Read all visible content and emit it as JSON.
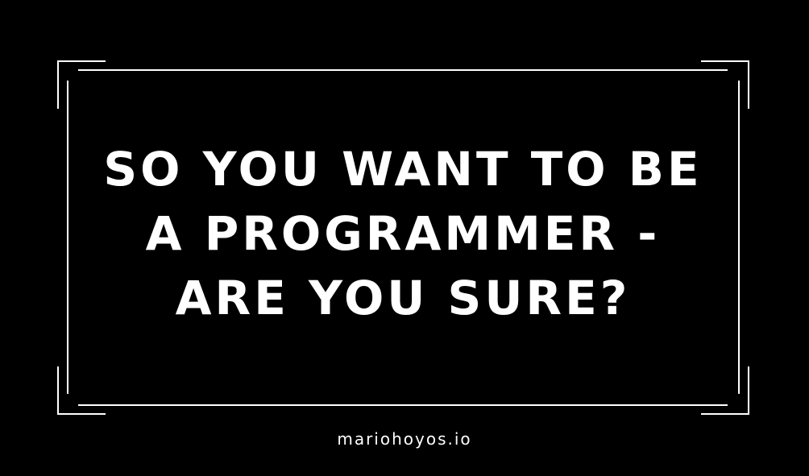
{
  "colors": {
    "background": "#000000",
    "foreground": "#ffffff"
  },
  "headline": {
    "lines": [
      "SO YOU WANT TO BE",
      "A PROGRAMMER -",
      "ARE YOU SURE?"
    ]
  },
  "footer": {
    "url": "mariohoyos.io"
  }
}
